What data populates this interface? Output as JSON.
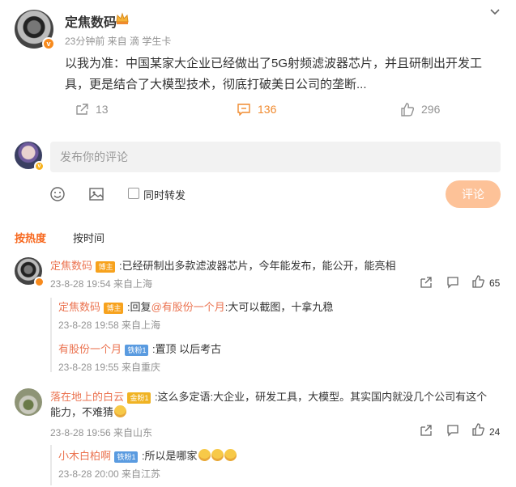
{
  "post": {
    "author": "定焦数码",
    "meta": "23分钟前  来自 滴 学生卡",
    "text": "以我为准：中国某家大企业已经做出了5G射频滤波器芯片，并且研制出开发工具，更是结合了大模型技术，彻底打破美日公司的垄断...",
    "reposts": "13",
    "comments": "136",
    "likes": "296"
  },
  "composer": {
    "placeholder": "发布你的评论",
    "repost_label": "同时转发",
    "submit_label": "评论"
  },
  "sort_tabs": [
    "按热度",
    "按时间"
  ],
  "comments": [
    {
      "author": "定焦数码",
      "badge": "博主",
      "text": ":已经研制出多款滤波器芯片，今年能发布，能公开，能亮相",
      "meta": "23-8-28 19:54 来自上海",
      "likes": "65",
      "replies": [
        {
          "author": "定焦数码",
          "badge": "博主",
          "prefix": ":回复",
          "mention": "@有股份一个月",
          "text": ":大可以截图，十拿九稳",
          "meta": "23-8-28 19:58 来自上海"
        },
        {
          "author": "有股份一个月",
          "badge": "铁粉1",
          "text": ":置顶 以后考古",
          "meta": "23-8-28 19:55 来自重庆"
        }
      ]
    },
    {
      "author": "落在地上的白云",
      "badge": "金粉1",
      "text_line1": ":这么多定语:大企业，研发工具，大模型。其实国内就没几个公司有这个",
      "text_line2": "能力，不难猜",
      "meta": "23-8-28 19:56 来自山东",
      "likes": "24",
      "replies": [
        {
          "author": "小木白柏啊",
          "badge": "铁粉1",
          "text": ":所以是哪家",
          "meta": "23-8-28 20:00 来自江苏"
        }
      ]
    }
  ],
  "colors": {
    "accent": "#f7671d",
    "name": "#eb7350",
    "submit_disabled": "#fdc298",
    "meta": "#939393"
  }
}
